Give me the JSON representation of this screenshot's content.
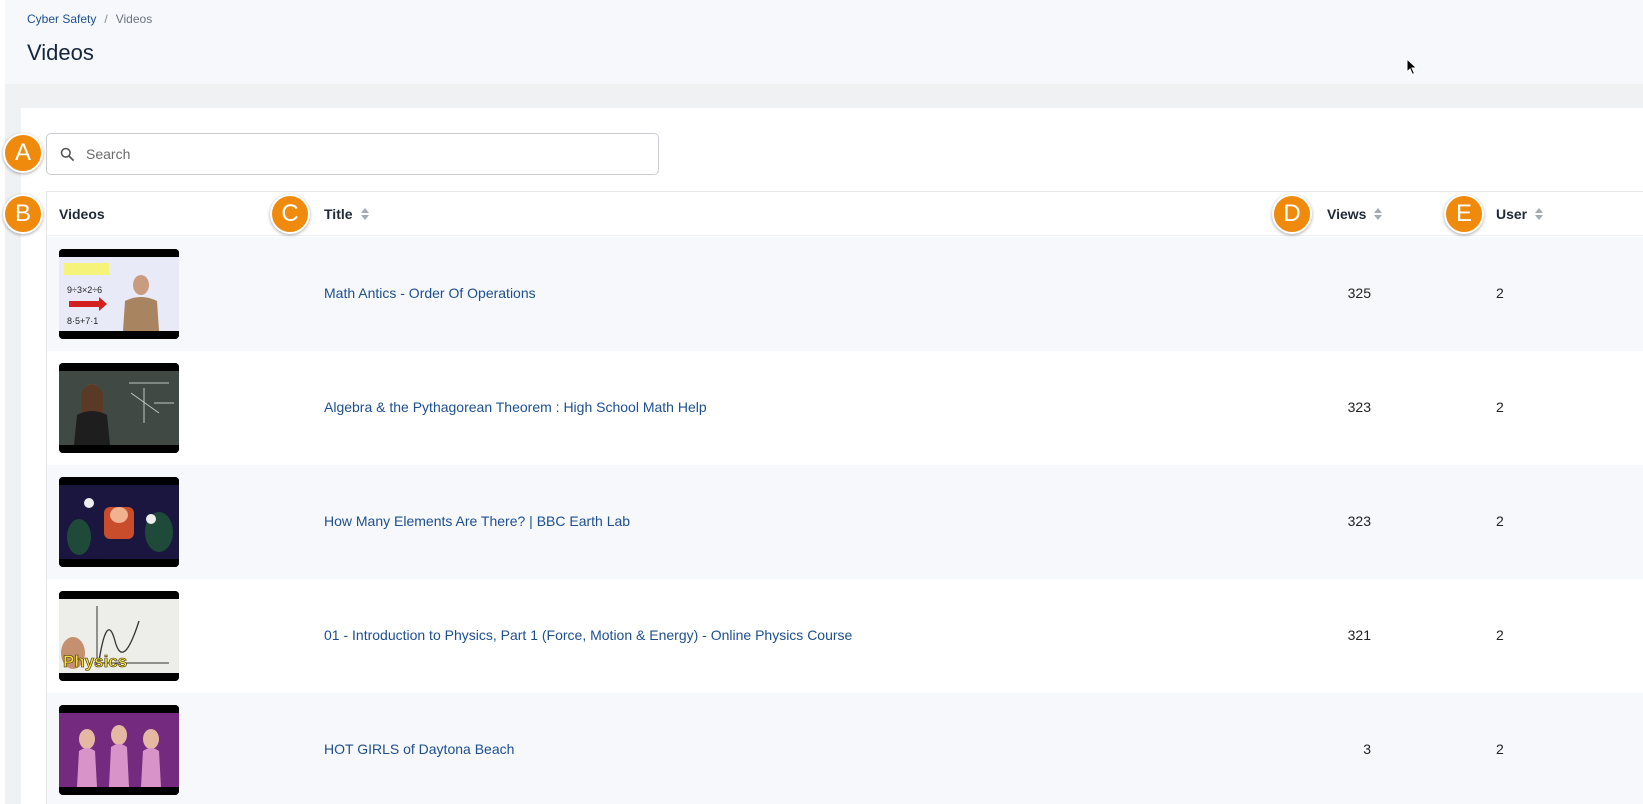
{
  "breadcrumb": {
    "root": "Cyber Safety",
    "separator": "/",
    "current": "Videos"
  },
  "page": {
    "title": "Videos"
  },
  "search": {
    "placeholder": "Search"
  },
  "table": {
    "columns": {
      "videos": "Videos",
      "title": "Title",
      "views": "Views",
      "user": "User"
    },
    "rows": [
      {
        "title": "Math Antics - Order Of Operations",
        "views": "325",
        "user": "2"
      },
      {
        "title": "Algebra & the Pythagorean Theorem : High School Math Help",
        "views": "323",
        "user": "2"
      },
      {
        "title": "How Many Elements Are There? | BBC Earth Lab",
        "views": "323",
        "user": "2"
      },
      {
        "title": "01 - Introduction to Physics, Part 1 (Force, Motion & Energy) - Online Physics Course",
        "views": "321",
        "user": "2",
        "thumb_caption": "Physics"
      },
      {
        "title": "HOT GIRLS of Daytona Beach",
        "views": "3",
        "user": "2"
      }
    ]
  },
  "thumb_overlay": {
    "problem": "9÷3×2÷6",
    "steps": "8·5+7·1"
  },
  "markers": [
    "A",
    "B",
    "C",
    "D",
    "E"
  ],
  "colors": {
    "accent": "#f08a0c",
    "link": "#1d4f91"
  }
}
